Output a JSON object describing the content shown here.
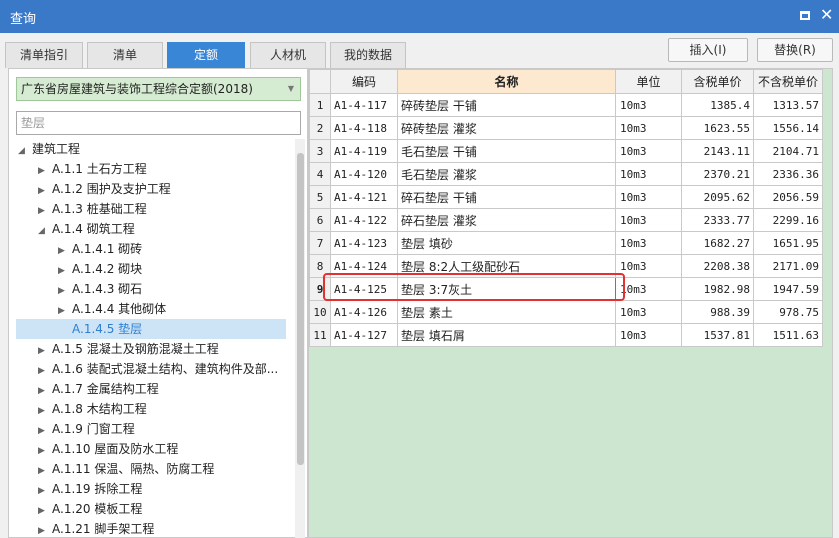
{
  "window": {
    "title": "查询"
  },
  "tabs": [
    "清单指引",
    "清单",
    "定额",
    "人材机",
    "我的数据"
  ],
  "buttons": {
    "insert": "插入(I)",
    "replace": "替换(R)"
  },
  "library": "广东省房屋建筑与装饰工程综合定额(2018)",
  "search": {
    "value": "",
    "placeholder": "垫层"
  },
  "tree": [
    "建筑工程",
    "A.1.1 土石方工程",
    "A.1.2 围护及支护工程",
    "A.1.3 桩基础工程",
    "A.1.4 砌筑工程",
    "A.1.4.1 砌砖",
    "A.1.4.2 砌块",
    "A.1.4.3 砌石",
    "A.1.4.4 其他砌体",
    "A.1.4.5 垫层",
    "A.1.5 混凝土及钢筋混凝土工程",
    "A.1.6 装配式混凝土结构、建筑构件及部...",
    "A.1.7 金属结构工程",
    "A.1.8 木结构工程",
    "A.1.9 门窗工程",
    "A.1.10 屋面及防水工程",
    "A.1.11 保温、隔热、防腐工程",
    "A.1.19 拆除工程",
    "A.1.20 模板工程",
    "A.1.21 脚手架工程"
  ],
  "table": {
    "headers": [
      "编码",
      "名称",
      "单位",
      "含税单价",
      "不含税单价"
    ],
    "rows": [
      [
        "1",
        "A1-4-117",
        "碎砖垫层 干铺",
        "10m3",
        "1385.4",
        "1313.57"
      ],
      [
        "2",
        "A1-4-118",
        "碎砖垫层 灌浆",
        "10m3",
        "1623.55",
        "1556.14"
      ],
      [
        "3",
        "A1-4-119",
        "毛石垫层 干铺",
        "10m3",
        "2143.11",
        "2104.71"
      ],
      [
        "4",
        "A1-4-120",
        "毛石垫层 灌浆",
        "10m3",
        "2370.21",
        "2336.36"
      ],
      [
        "5",
        "A1-4-121",
        "碎石垫层 干铺",
        "10m3",
        "2095.62",
        "2056.59"
      ],
      [
        "6",
        "A1-4-122",
        "碎石垫层 灌浆",
        "10m3",
        "2333.77",
        "2299.16"
      ],
      [
        "7",
        "A1-4-123",
        "垫层 填砂",
        "10m3",
        "1682.27",
        "1651.95"
      ],
      [
        "8",
        "A1-4-124",
        "垫层 8:2人工级配砂石",
        "10m3",
        "2208.38",
        "2171.09"
      ],
      [
        "9",
        "A1-4-125",
        "垫层 3:7灰土",
        "10m3",
        "1982.98",
        "1947.59"
      ],
      [
        "10",
        "A1-4-126",
        "垫层 素土",
        "10m3",
        "988.39",
        "978.75"
      ],
      [
        "11",
        "A1-4-127",
        "垫层 填石屑",
        "10m3",
        "1537.81",
        "1511.63"
      ]
    ]
  },
  "colors": {
    "titlebar": "#3a78c8",
    "active_tab": "#3a86d6",
    "highlight": "#e53030",
    "grid_background": "#cde6d0",
    "library_select": "#d6ecd2"
  }
}
